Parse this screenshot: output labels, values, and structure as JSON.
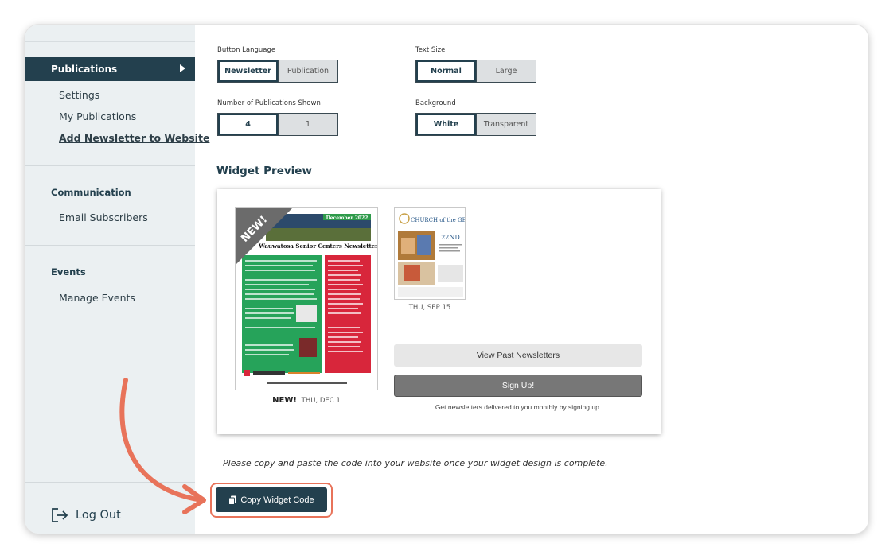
{
  "sidebar": {
    "active_section": "Publications",
    "publications_items": [
      {
        "label": "Settings"
      },
      {
        "label": "My Publications"
      },
      {
        "label": "Add Newsletter to Website"
      }
    ],
    "communication": {
      "title": "Communication",
      "items": [
        {
          "label": "Email Subscribers"
        }
      ]
    },
    "events": {
      "title": "Events",
      "items": [
        {
          "label": "Manage Events"
        }
      ]
    },
    "logout_label": "Log Out"
  },
  "options": {
    "button_language": {
      "label": "Button Language",
      "selected": "Newsletter",
      "other": "Publication"
    },
    "text_size": {
      "label": "Text Size",
      "selected": "Normal",
      "other": "Large"
    },
    "pubs_shown": {
      "label": "Number of Publications Shown",
      "selected": "4",
      "other": "1"
    },
    "background": {
      "label": "Background",
      "selected": "White",
      "other": "Transparent"
    }
  },
  "preview": {
    "title": "Widget Preview",
    "pub1": {
      "badge": "NEW!",
      "new_label": "NEW!",
      "date": "THU, DEC 1",
      "cover_month": "December 2022",
      "cover_title": "Wauwatosa Senior Centers Newsletter"
    },
    "pub2": {
      "date": "THU, SEP 15",
      "cover_title": "CHURCH of the GESU",
      "cover_num": "22ND"
    },
    "view_past_label": "View Past Newsletters",
    "signup_label": "Sign Up!",
    "signup_note": "Get newsletters delivered to you monthly by signing up."
  },
  "instruction": "Please copy and paste the code into your website once your widget design is complete.",
  "copy_button_label": "Copy Widget Code",
  "colors": {
    "primary": "#23404e",
    "accent_arrow": "#e8735a",
    "sidebar_bg": "#ebf0f2"
  }
}
